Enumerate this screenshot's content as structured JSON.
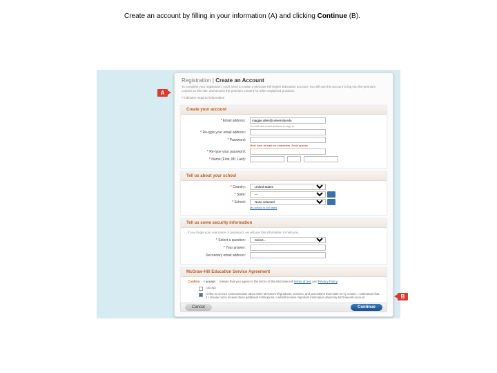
{
  "instruction": {
    "pre": "Create an account by filling in your information (A) and clicking ",
    "bold": "Continue",
    "post": " (B)."
  },
  "callouts": {
    "a": "A",
    "b": "B"
  },
  "header": {
    "title_light": "Registration",
    "title_sep": " | ",
    "title_strong": "Create an Account",
    "sub": "To complete your registration, you'll need to create a McGraw-Hill Higher Education account. You will use this account to log into the premium content on this site, and access the premium content for other registered products.",
    "required": "Indicates required information"
  },
  "sections": {
    "account": {
      "title": "Create your account",
      "email_label": "Email address:",
      "email_value": "maggie.allen@university.edu",
      "email_hint": "You will use email address to sign in.",
      "retype_email_label": "Re-type your email address:",
      "password_label": "Password:",
      "password_hint": "Must have at least six characters. Avoid spaces.",
      "retype_password_label": "Re-type your password:",
      "name_label": "Name (First, MI, Last):"
    },
    "school": {
      "title": "Tell us about your school",
      "country_label": "Country:",
      "country_value": "United States",
      "state_label": "State:",
      "state_value": "—",
      "school_label": "School:",
      "school_value": "None selected",
      "school_link": "My school is not listed"
    },
    "security": {
      "title": "Tell us some security information",
      "note": "If you forget your username or password, we will use this information to help you.",
      "question_label": "Select a question:",
      "question_value": "Select...",
      "answer_label": "Your answer:",
      "secondary_label": "Secondary email address:"
    },
    "agreement": {
      "title": "McGraw-Hill Education Service Agreement",
      "confirm_strong": "Confirm",
      "confirm_label": "I accept",
      "confirm_text_pre": "means that you agree to the terms of the McGraw-Hill ",
      "confirm_link1": "terms of use",
      "confirm_text_mid": " and ",
      "confirm_link2": "Privacy Policy",
      "confirm_text_post": ".",
      "opt1": "I accept",
      "opt2": "I'd like to receive communication about other McGraw-Hill products, services, and promotions that relate to my course. I understand that if I choose not to receive these additional notifications, I will still receive important information about my McGraw-Hill account."
    }
  },
  "footer": {
    "cancel": "Cancel",
    "continue": "Continue"
  }
}
